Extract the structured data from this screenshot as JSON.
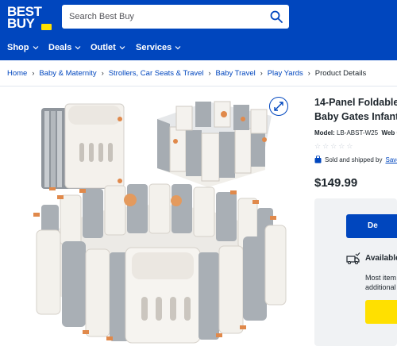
{
  "header": {
    "logo_line1": "BEST",
    "logo_line2": "BUY",
    "search_placeholder": "Search Best Buy",
    "search_icon": "search-icon",
    "brand_color": "#0046be",
    "tag_color": "#ffe000"
  },
  "nav": {
    "items": [
      {
        "label": "Shop"
      },
      {
        "label": "Deals"
      },
      {
        "label": "Outlet"
      },
      {
        "label": "Services"
      }
    ]
  },
  "breadcrumb": {
    "items": [
      "Home",
      "Baby & Maternity",
      "Strollers, Car Seats & Travel",
      "Baby Travel",
      "Play Yards"
    ],
    "current": "Product Details"
  },
  "product": {
    "title_line1": "14-Panel Foldable",
    "title_line2": "Baby Gates Infant",
    "model_label": "Model:",
    "model_value": "LB-ABST-W25",
    "web_code_label": "Web Co",
    "sold_by_text": "Sold and shipped by",
    "seller": "Save",
    "price": "$149.99",
    "rating_stars": 0
  },
  "buy_box": {
    "add_to_cart_label": "De",
    "availability_title": "Available",
    "availability_note_line1": "Most item",
    "availability_note_line2": "additional"
  }
}
